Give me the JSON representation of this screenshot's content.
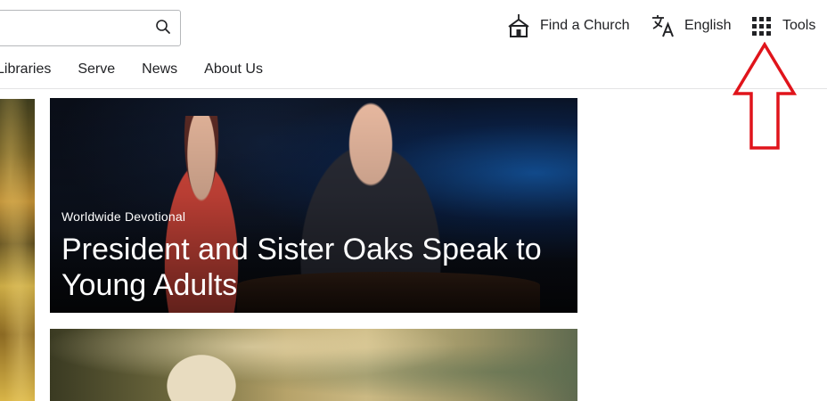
{
  "header": {
    "search": {
      "value": "",
      "placeholder": ""
    },
    "utilities": {
      "find_church": "Find a Church",
      "language": "English",
      "tools": "Tools"
    }
  },
  "nav": {
    "items": [
      {
        "label": "Libraries"
      },
      {
        "label": "Serve"
      },
      {
        "label": "News"
      },
      {
        "label": "About Us"
      }
    ]
  },
  "hero": {
    "kicker": "Worldwide Devotional",
    "headline": "President and Sister Oaks Speak to Young Adults"
  },
  "icons": {
    "search": "search-icon",
    "church": "church-icon",
    "translate": "translate-icon",
    "grid": "grid-icon"
  },
  "colors": {
    "annotation": "#e0141b",
    "text": "#212225"
  }
}
